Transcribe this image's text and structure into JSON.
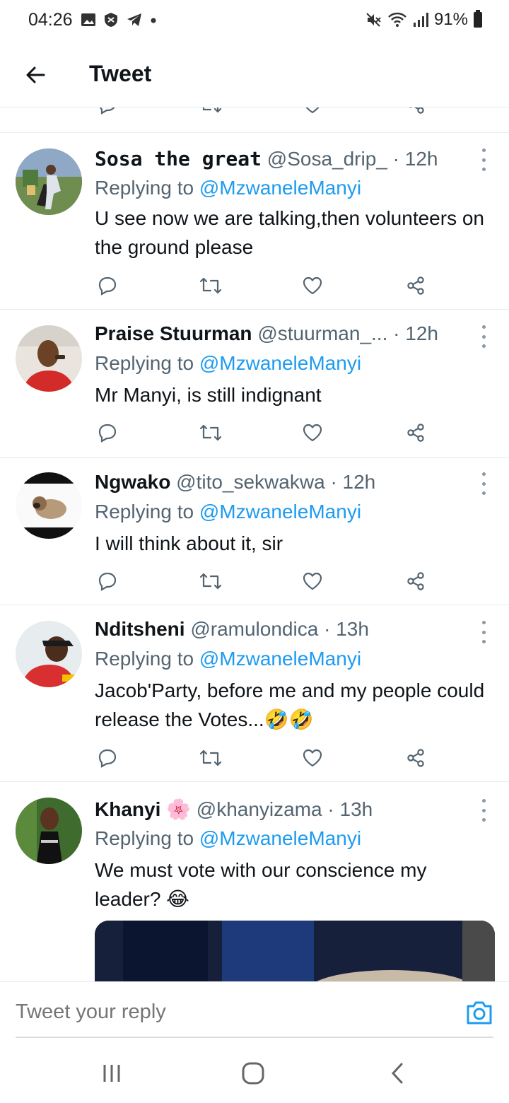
{
  "status_bar": {
    "time": "04:26",
    "battery": "91%",
    "left_icons": [
      "image-icon",
      "shield-icon",
      "telegram-icon",
      "dot-icon"
    ],
    "right_icons": [
      "mute-icon",
      "wifi-icon",
      "signal-icon",
      "battery-icon"
    ]
  },
  "header": {
    "title": "Tweet",
    "back_icon": "arrow-left-icon"
  },
  "colors": {
    "accent": "#1d9bf0",
    "secondary_text": "#536471",
    "primary_text": "#0f1419",
    "divider": "#e6ecf0"
  },
  "tweets": [
    {
      "name": "Sosa the great",
      "handle": "@Sosa_drip_",
      "time": "· 12h",
      "reply_label": "Replying to",
      "reply_to": "@MzwaneleManyi",
      "text": "U see now we are talking,then volunteers on the ground please"
    },
    {
      "name": "Praise Stuurman",
      "handle": "@stuurman_...",
      "time": "· 12h",
      "reply_label": "Replying to",
      "reply_to": "@MzwaneleManyi",
      "text": "Mr Manyi, is still indignant"
    },
    {
      "name": "Ngwako",
      "handle": "@tito_sekwakwa",
      "time": "· 12h",
      "reply_label": "Replying to",
      "reply_to": "@MzwaneleManyi",
      "text": "I will think about it, sir"
    },
    {
      "name": "Nditsheni",
      "handle": "@ramulondica",
      "time": "· 13h",
      "reply_label": "Replying to",
      "reply_to": "@MzwaneleManyi",
      "text": "Jacob'Party, before me and my people could release the Votes...🤣🤣"
    },
    {
      "name": "Khanyi 🌸",
      "handle": "@khanyizama",
      "time": "· 13h",
      "reply_label": "Replying to",
      "reply_to": "@MzwaneleManyi",
      "text": "We must vote with our conscience my leader? 😂"
    }
  ],
  "composer": {
    "placeholder": "Tweet your reply",
    "camera_icon": "camera-icon"
  },
  "navbar": {
    "buttons": [
      "recent-apps-icon",
      "home-icon",
      "back-icon"
    ]
  }
}
